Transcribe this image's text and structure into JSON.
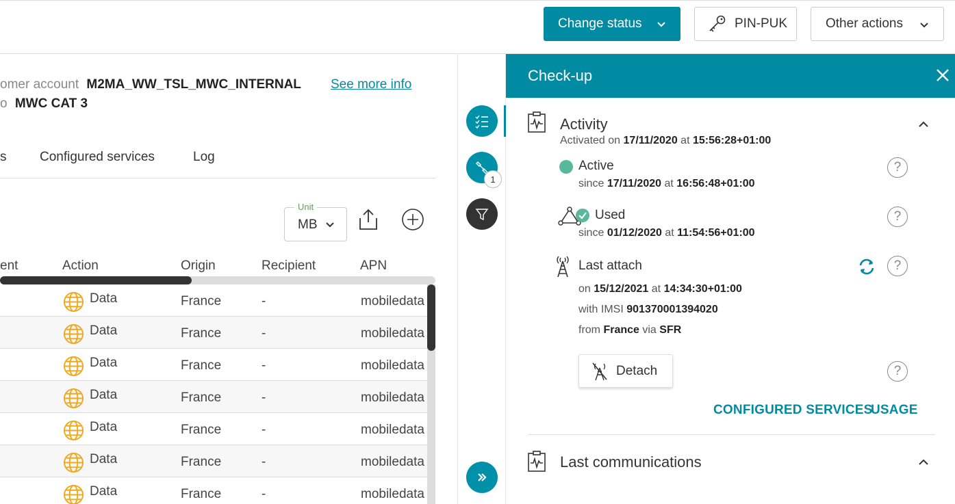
{
  "topbar": {
    "change_status": "Change status",
    "pin_puk": "PIN-PUK",
    "other_actions": "Other actions"
  },
  "info": {
    "customer_label": "omer account",
    "customer_value": "M2MA_WW_TSL_MWC_INTERNAL",
    "offer_label": "o",
    "offer_value": "MWC CAT 3",
    "see_more": "See more info"
  },
  "tabs": [
    "s",
    "Configured services",
    "Log"
  ],
  "toolbar": {
    "unit_label": "Unit",
    "unit_value": "MB"
  },
  "table": {
    "columns": [
      "ent",
      "Action",
      "Origin",
      "Recipient",
      "APN"
    ],
    "rows": [
      {
        "action": "Data",
        "origin": "France",
        "recipient": "-",
        "apn": "mobiledata"
      },
      {
        "action": "Data",
        "origin": "France",
        "recipient": "-",
        "apn": "mobiledata"
      },
      {
        "action": "Data",
        "origin": "France",
        "recipient": "-",
        "apn": "mobiledata"
      },
      {
        "action": "Data",
        "origin": "France",
        "recipient": "-",
        "apn": "mobiledata"
      },
      {
        "action": "Data",
        "origin": "France",
        "recipient": "-",
        "apn": "mobiledata"
      },
      {
        "action": "Data",
        "origin": "France",
        "recipient": "-",
        "apn": "mobiledata"
      },
      {
        "action": "Data",
        "origin": "France",
        "recipient": "-",
        "apn": "mobiledata"
      }
    ]
  },
  "rail": {
    "badge_count": "1"
  },
  "checkup": {
    "title": "Check-up",
    "activity": {
      "title": "Activity",
      "activated_prefix": "Activated on",
      "activated_date": "17/11/2020",
      "at": "at",
      "activated_time": "15:56:28+01:00",
      "active_label": "Active",
      "since": "since",
      "active_date": "17/11/2020",
      "active_time": "16:56:48+01:00",
      "used_label": "Used",
      "used_date": "01/12/2020",
      "used_time": "11:54:56+01:00",
      "attach_label": "Last attach",
      "on": "on",
      "attach_date": "15/12/2021",
      "attach_time": "14:34:30+01:00",
      "imsi_prefix": "with IMSI",
      "imsi": "901370001394020",
      "from": "from",
      "country": "France",
      "via": "via",
      "operator": "SFR",
      "detach": "Detach",
      "configured_services": "CONFIGURED SERVICES",
      "usage": "USAGE"
    },
    "last_comms": {
      "title": "Last communications"
    },
    "help": "?"
  },
  "colors": {
    "accent": "#008ba3",
    "active_dot": "#5ab89a",
    "globe": "#f0a81c"
  }
}
